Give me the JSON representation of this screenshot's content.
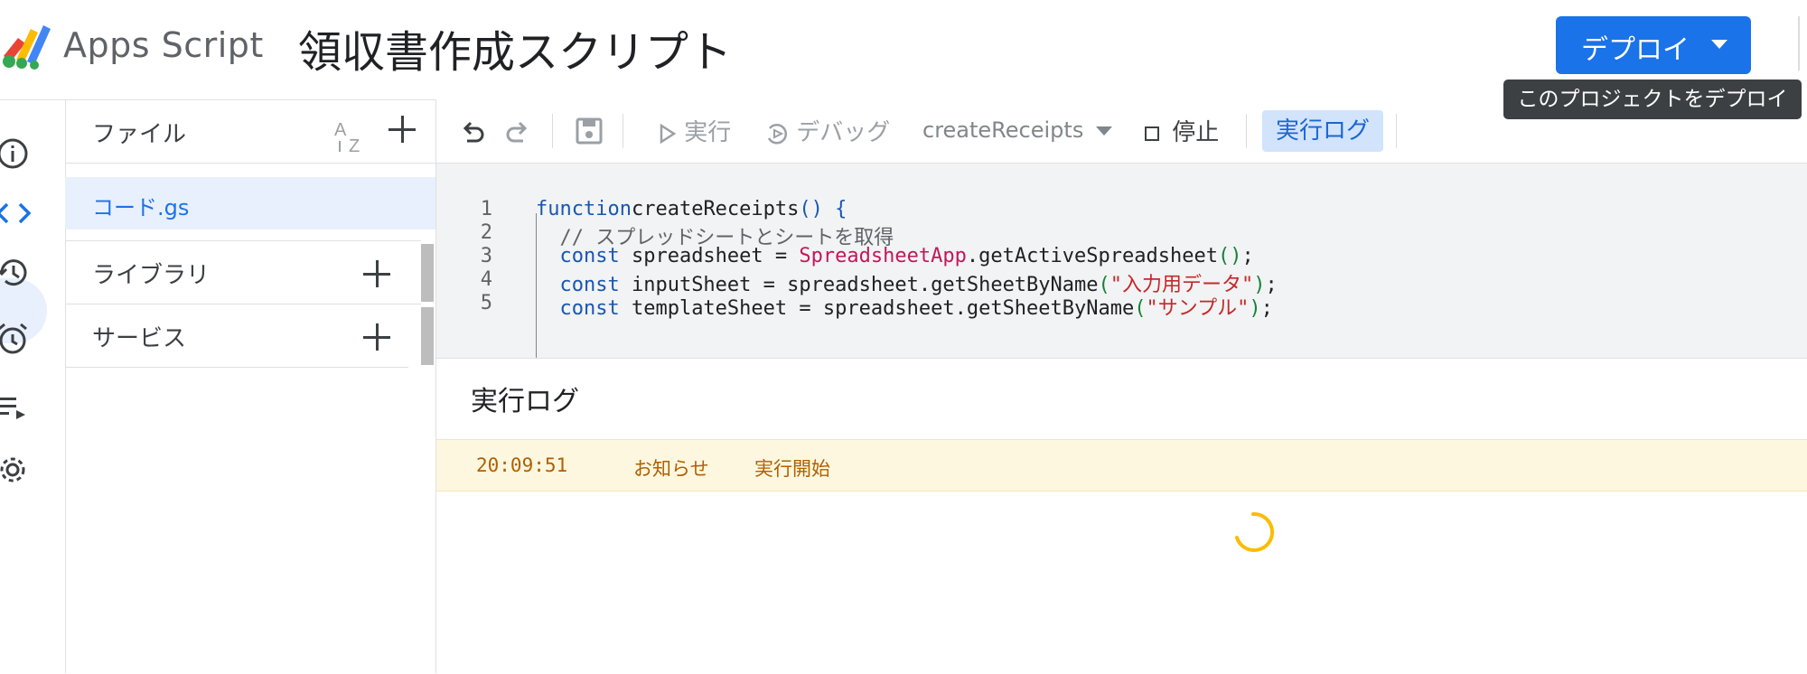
{
  "header": {
    "app_name": "Apps Script",
    "project_title": "領収書作成スクリプト",
    "deploy_label": "デプロイ",
    "deploy_tooltip": "このプロジェクトをデプロイ"
  },
  "rail": {
    "items": [
      {
        "name": "overview",
        "icon": "info-icon"
      },
      {
        "name": "editor",
        "icon": "code-icon",
        "active": true
      },
      {
        "name": "versions",
        "icon": "history-icon"
      },
      {
        "name": "triggers",
        "icon": "alarm-icon"
      },
      {
        "name": "executions",
        "icon": "executions-icon"
      },
      {
        "name": "settings",
        "icon": "gear-icon"
      }
    ]
  },
  "files": {
    "title": "ファイル",
    "sort_icon": "sort-az-icon",
    "items": [
      {
        "name": "コード.gs",
        "selected": true
      }
    ],
    "libraries_title": "ライブラリ",
    "services_title": "サービス"
  },
  "toolbar": {
    "undo": "undo-icon",
    "redo": "redo-icon",
    "save": "save-icon",
    "run_label": "実行",
    "debug_label": "デバッグ",
    "function_select": "createReceipts",
    "stop_label": "停止",
    "log_label": "実行ログ"
  },
  "editor": {
    "lines": [
      {
        "n": "1",
        "parts": [
          [
            "kw",
            "function"
          ],
          [
            "",
            "createReceipts"
          ],
          [
            "kw",
            "() {"
          ]
        ]
      },
      {
        "n": "2",
        "parts": [
          [
            "cmt",
            "  // スプレッドシートとシートを取得"
          ]
        ]
      },
      {
        "n": "3",
        "parts": [
          [
            "kw",
            "  const"
          ],
          [
            "",
            " spreadsheet = "
          ],
          [
            "cls",
            "SpreadsheetApp"
          ],
          [
            "",
            ".getActiveSpreadsheet"
          ],
          [
            "paren",
            "()"
          ],
          [
            "",
            ";"
          ]
        ]
      },
      {
        "n": "4",
        "parts": [
          [
            "kw",
            "  const"
          ],
          [
            "",
            " inputSheet = spreadsheet.getSheetByName"
          ],
          [
            "paren",
            "("
          ],
          [
            "str",
            "\"入力用データ\""
          ],
          [
            "paren",
            ")"
          ],
          [
            "",
            ";"
          ]
        ]
      },
      {
        "n": "5",
        "parts": [
          [
            "kw",
            "  const"
          ],
          [
            "",
            " templateSheet = spreadsheet.getSheetByName"
          ],
          [
            "paren",
            "("
          ],
          [
            "str",
            "\"サンプル\""
          ],
          [
            "paren",
            ")"
          ],
          [
            "",
            ";"
          ]
        ]
      }
    ]
  },
  "log": {
    "title": "実行ログ",
    "entries": [
      {
        "time": "20:09:51",
        "severity": "お知らせ",
        "message": "実行開始"
      }
    ]
  },
  "colors": {
    "accent": "#1a73e8",
    "log_warn_bg": "#fef7e0",
    "spinner": "#fbbc04"
  }
}
